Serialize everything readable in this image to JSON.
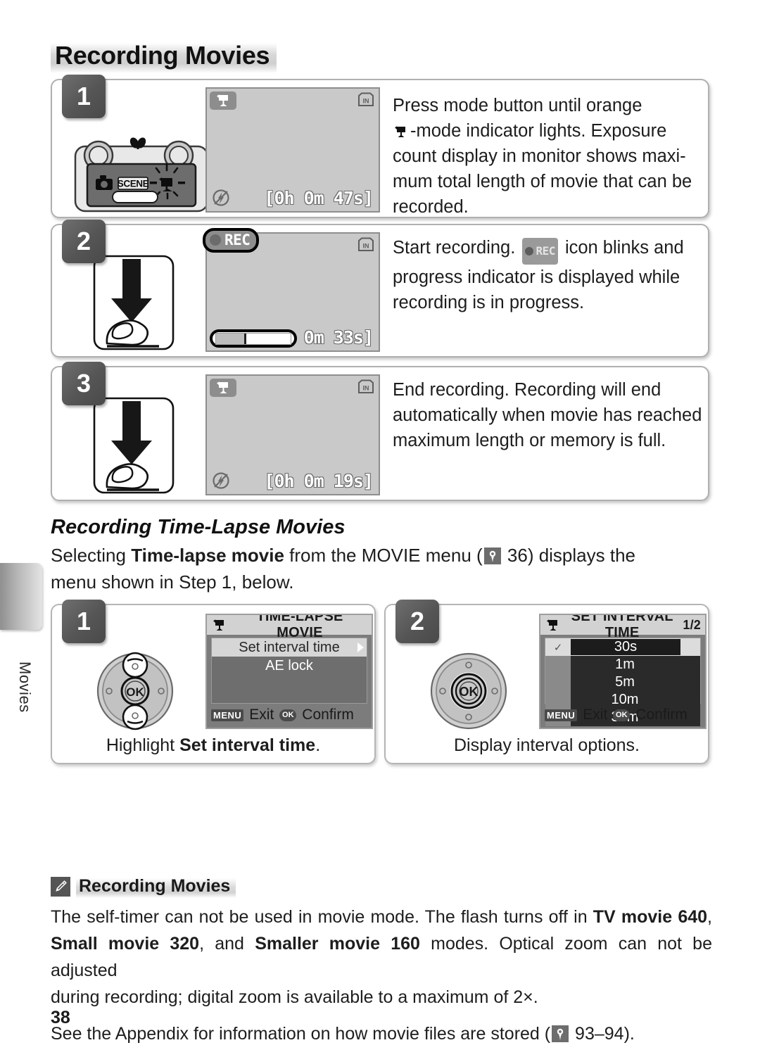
{
  "page": {
    "title": "Recording Movies",
    "number": "38",
    "side_tab_label": "Movies"
  },
  "steps": [
    {
      "number": "1",
      "lcd": {
        "movie_icon": "movie-mode-icon",
        "in_icon": "IN",
        "flash_icon": "flash-off-icon",
        "count": "[0h 0m 47s]"
      },
      "camera": {
        "photo_icon": "camera-icon",
        "scene_label": "SCENE",
        "movie_icon": "movie-mode-icon",
        "macro_icon": "macro-flower-icon"
      },
      "text": "Press mode button until orange -mode indicator lights. Exposure count display in monitor shows maxi-",
      "text_lines": [
        "Press mode button until orange",
        "-mode indicator lights.  Exposure",
        "count display in monitor shows maxi-",
        "mum total length of movie that can be",
        "recorded."
      ]
    },
    {
      "number": "2",
      "lcd": {
        "rec_label": "REC",
        "in_icon": "IN",
        "count": "0h 0m 33s]",
        "progress_percent": 38
      },
      "text_lines": [
        "Start recording.",
        "icon blinks and",
        "progress indicator is displayed while",
        "recording is in progress."
      ]
    },
    {
      "number": "3",
      "lcd": {
        "movie_icon": "movie-mode-icon",
        "in_icon": "IN",
        "flash_icon": "flash-off-icon",
        "count": "[0h 0m 19s]"
      },
      "text_lines": [
        "End recording.   Recording will end",
        "automatically when movie has reached",
        "maximum length or memory is full."
      ]
    }
  ],
  "timelapse": {
    "heading": "Recording Time-Lapse Movies",
    "intro_lines": [
      "Selecting ",
      "Time-lapse movie",
      " from the MOVIE menu (",
      " 36) displays the",
      "menu shown in Step 1, below."
    ],
    "intro_part1": "Selecting ",
    "intro_bold": "Time-lapse movie",
    "intro_part2": " from the MOVIE menu (",
    "intro_page_ref": " 36) displays the",
    "intro_last_line": "menu shown in Step 1, below.",
    "panels": [
      {
        "number": "1",
        "screen": {
          "title": "TIME-LAPSE MOVIE",
          "page_indicator": "",
          "rows": [
            {
              "label": "Set interval time",
              "selected": true,
              "has_arrow": true
            },
            {
              "label": "AE lock",
              "selected": false,
              "has_arrow": false
            }
          ],
          "footer_exit": "Exit",
          "footer_confirm": "Confirm",
          "badge_menu": "MENU",
          "badge_ok": "OK"
        },
        "dial": {
          "ok_label": "OK",
          "highlight": "up-down"
        },
        "caption_plain": "Highlight ",
        "caption_bold": "Set interval time",
        "caption_end": "."
      },
      {
        "number": "2",
        "screen": {
          "title": "SET INTERVAL TIME",
          "page_indicator": "1/2",
          "options": [
            {
              "value": "30s",
              "selected": true,
              "check": "✓"
            },
            {
              "value": "1m",
              "selected": false,
              "check": ""
            },
            {
              "value": "5m",
              "selected": false,
              "check": ""
            },
            {
              "value": "10m",
              "selected": false,
              "check": ""
            },
            {
              "value": "30m",
              "selected": false,
              "check": ""
            }
          ],
          "footer_exit": "Exit",
          "footer_confirm": "Confirm",
          "badge_menu": "MENU",
          "badge_ok": "OK"
        },
        "dial": {
          "ok_label": "OK",
          "highlight": "ok"
        },
        "caption_plain": "Display interval options.",
        "caption_bold": "",
        "caption_end": ""
      }
    ]
  },
  "note": {
    "title": "Recording Movies",
    "icon": "pencil-icon",
    "paragraph1": {
      "p1": "The self-timer can not be used in movie mode.  The flash turns off in ",
      "b1": "TV movie 640",
      "p2": ", ",
      "b2": "Small movie 320",
      "p3": ", and ",
      "b3": "Smaller movie 160",
      "p4": " modes.  Optical zoom can not be adjusted",
      "last": "during recording; digital zoom is available to a maximum of 2×."
    },
    "paragraph2": {
      "p1": "See the Appendix for information on how movie files are stored (",
      "p2": " 93–94)."
    }
  },
  "colors": {
    "lcd_background": "#c9c9c9",
    "menu_background": "#6e6e6e",
    "selected_row": "#d6d6d6",
    "option_background": "#2a2a2a",
    "step_number_box": "#555555"
  }
}
